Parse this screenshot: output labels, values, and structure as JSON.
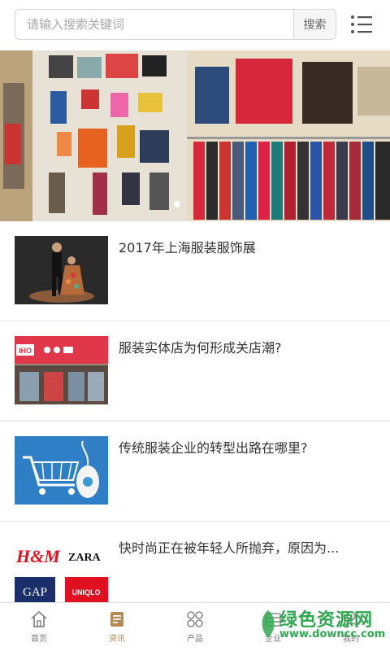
{
  "search": {
    "placeholder": "请输入搜索关键词",
    "button_label": "搜索"
  },
  "banner": {
    "icon": "clothing-store-photo",
    "slide_count": 1,
    "active_slide": 1
  },
  "news": [
    {
      "title": "2017年上海服装服饰展",
      "thumb_icon": "fashion-dancer-photo"
    },
    {
      "title": "服装实体店为何形成关店潮?",
      "thumb_icon": "storefront-photo",
      "thumb_sign": "IHO"
    },
    {
      "title": "传统服装企业的转型出路在哪里?",
      "thumb_icon": "cart-mouse-photo"
    },
    {
      "title": "快时尚正在被年轻人所抛弃，原因为...",
      "thumb_icon": "brand-logos-photo",
      "brands": [
        "H&M",
        "ZARA",
        "GAP",
        "UNIQLO"
      ]
    }
  ],
  "nav": {
    "items": [
      {
        "label": "首页",
        "icon": "home-icon"
      },
      {
        "label": "资讯",
        "icon": "news-icon",
        "active": true
      },
      {
        "label": "产品",
        "icon": "grid-icon"
      },
      {
        "label": "企业",
        "icon": "company-icon"
      },
      {
        "label": "我的",
        "icon": "user-icon"
      }
    ]
  },
  "watermark": {
    "text": "绿色资源网",
    "url": "www.downcc.com"
  },
  "colors": {
    "accent": "#b48a52",
    "watermark": "#2fa84f"
  }
}
